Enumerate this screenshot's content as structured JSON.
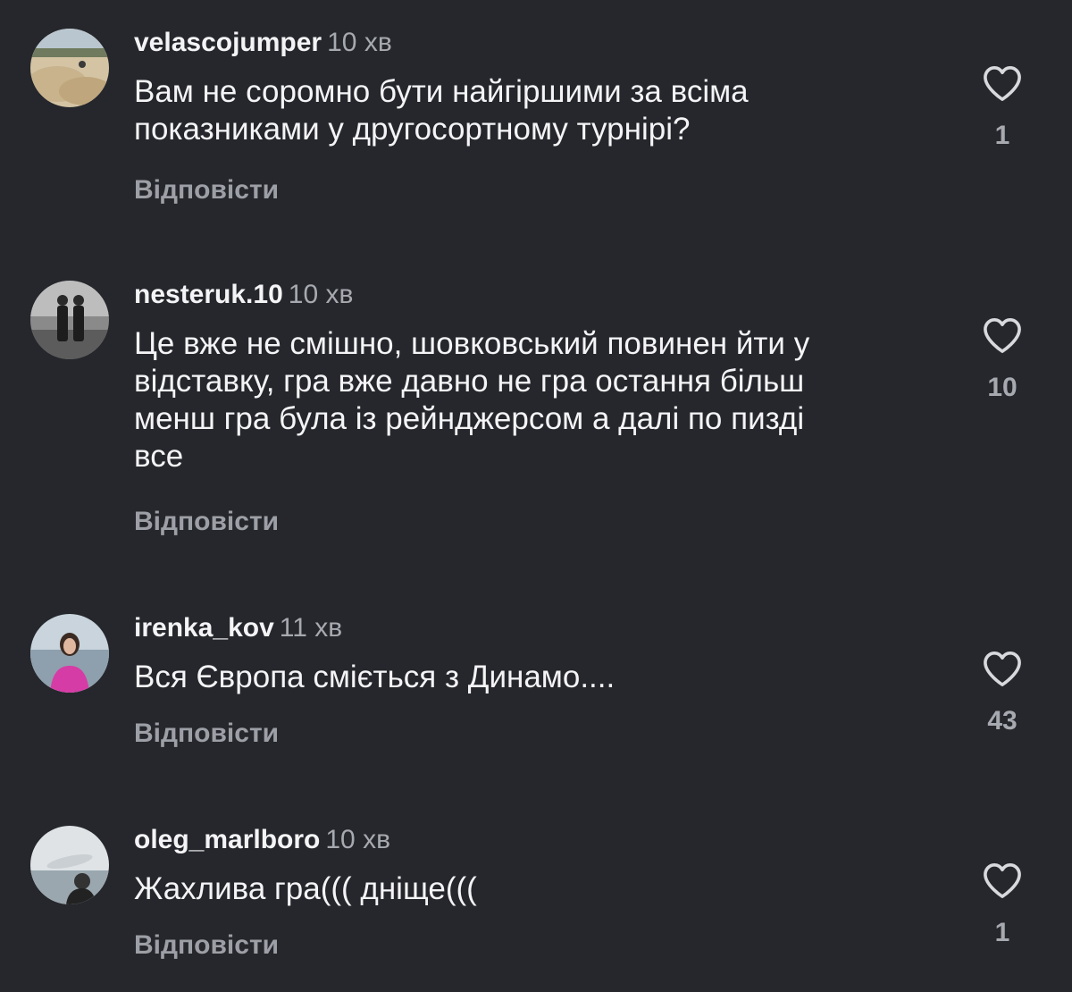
{
  "comments": [
    {
      "username": "velascojumper",
      "time": "10 хв",
      "text": "Вам не соромно бути найгіршими за всіма\nпоказниками у другосортному турнірі?",
      "reply_label": "Відповісти",
      "likes": "1",
      "like_icon": "heart-outline-icon"
    },
    {
      "username": "nesteruk.10",
      "time": "10 хв",
      "text": "Це вже не смішно, шовковський повинен йти у\nвідставку, гра вже давно не гра остання більш\nменш гра була із рейнджерсом а далі по пизді\nвсе",
      "reply_label": "Відповісти",
      "likes": "10",
      "like_icon": "heart-outline-icon"
    },
    {
      "username": "irenka_kov",
      "time": "11 хв",
      "text": "Вся Європа сміється з Динамо....",
      "reply_label": "Відповісти",
      "likes": "43",
      "like_icon": "heart-outline-icon"
    },
    {
      "username": "oleg_marlboro",
      "time": "10 хв",
      "text": "Жахлива гра((( дніще(((",
      "reply_label": "Відповісти",
      "likes": "1",
      "like_icon": "heart-outline-icon"
    }
  ]
}
